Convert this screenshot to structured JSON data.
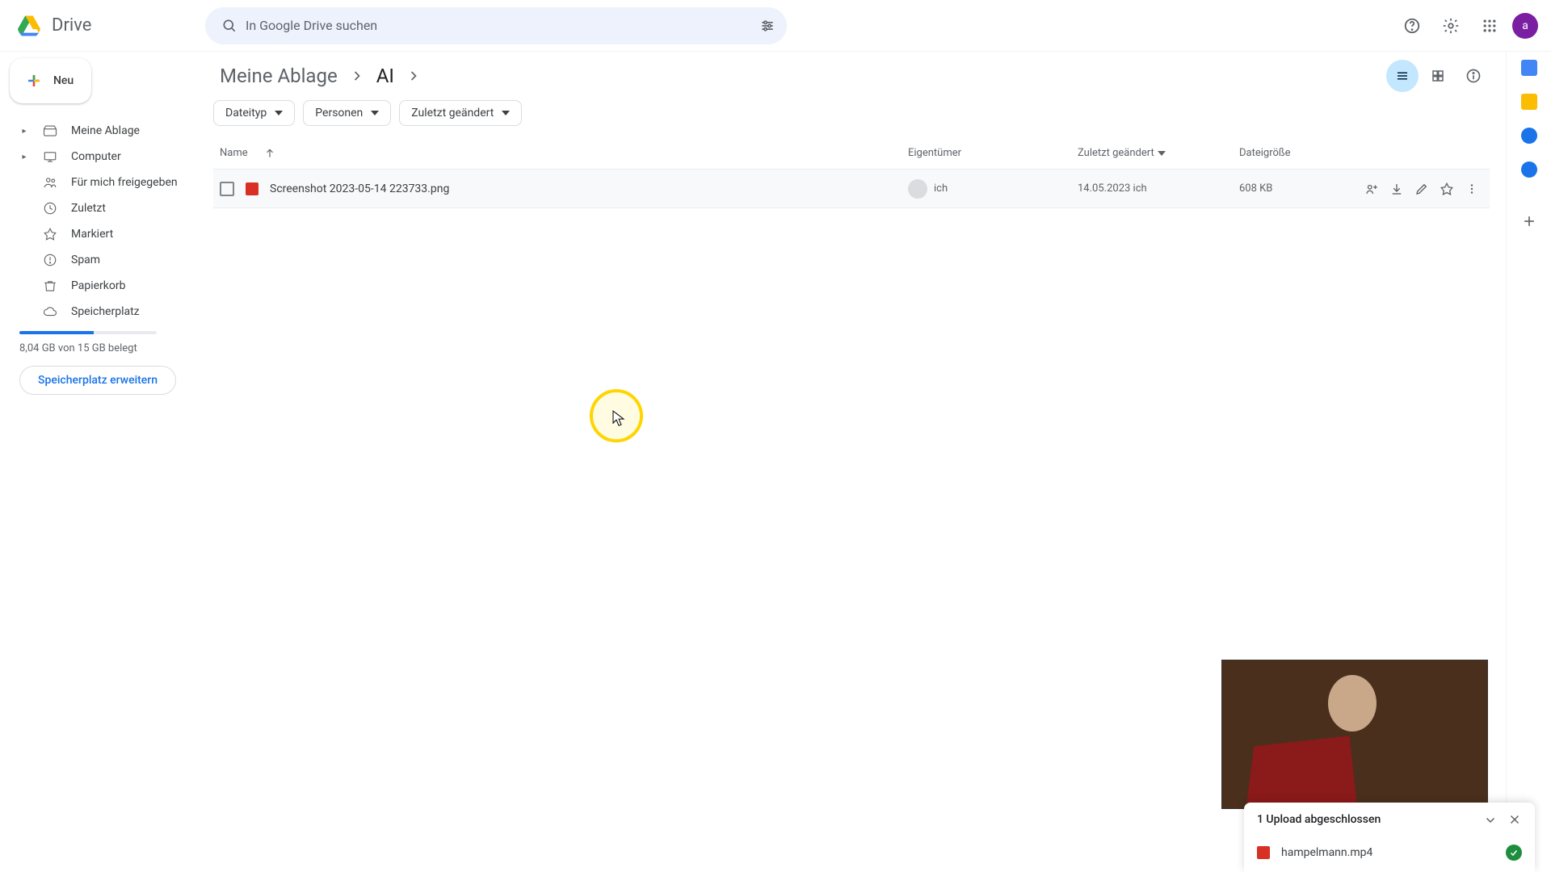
{
  "header": {
    "app_name": "Drive",
    "search_placeholder": "In Google Drive suchen",
    "avatar_initial": "a"
  },
  "sidebar": {
    "new_label": "Neu",
    "items": [
      {
        "label": "Meine Ablage",
        "icon": "mydrive",
        "expandable": true
      },
      {
        "label": "Computer",
        "icon": "computer",
        "expandable": true
      },
      {
        "label": "Für mich freigegeben",
        "icon": "shared"
      },
      {
        "label": "Zuletzt",
        "icon": "recent"
      },
      {
        "label": "Markiert",
        "icon": "starred"
      },
      {
        "label": "Spam",
        "icon": "spam"
      },
      {
        "label": "Papierkorb",
        "icon": "trash"
      },
      {
        "label": "Speicherplatz",
        "icon": "storage"
      }
    ],
    "storage_text": "8,04 GB von 15 GB belegt",
    "expand_label": "Speicherplatz erweitern"
  },
  "breadcrumb": {
    "root": "Meine Ablage",
    "current": "AI"
  },
  "filters": {
    "type": "Dateityp",
    "people": "Personen",
    "modified": "Zuletzt geändert"
  },
  "columns": {
    "name": "Name",
    "owner": "Eigentümer",
    "modified": "Zuletzt geändert",
    "size": "Dateigröße"
  },
  "files": [
    {
      "name": "Screenshot 2023-05-14 223733.png",
      "owner": "ich",
      "modified": "14.05.2023 ich",
      "size": "608 KB"
    }
  ],
  "upload": {
    "title": "1 Upload abgeschlossen",
    "item": "hampelmann.mp4"
  }
}
